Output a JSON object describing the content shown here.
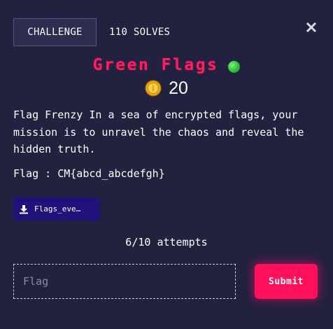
{
  "tabs": {
    "challenge": "CHALLENGE",
    "solves": "110 SOLVES"
  },
  "close_icon": "close-icon",
  "challenge": {
    "title": "Green Flags",
    "points": "20",
    "description": "Flag Frenzy In a sea of encrypted flags, your mission is to unravel the chaos and reveal the hidden truth.",
    "flag_hint": "Flag : CM{abcd_abcdefgh}",
    "file": {
      "label": "Flags_eve…",
      "icon": "download-icon"
    },
    "attempts": "6/10 attempts"
  },
  "form": {
    "placeholder": "Flag",
    "value": "",
    "submit_label": "Submit"
  },
  "colors": {
    "background": "#222140",
    "title": "#ff1f5e",
    "submit": "#ff0f5c",
    "file_button": "#20127a",
    "status_dot": "#2fbf3a"
  }
}
